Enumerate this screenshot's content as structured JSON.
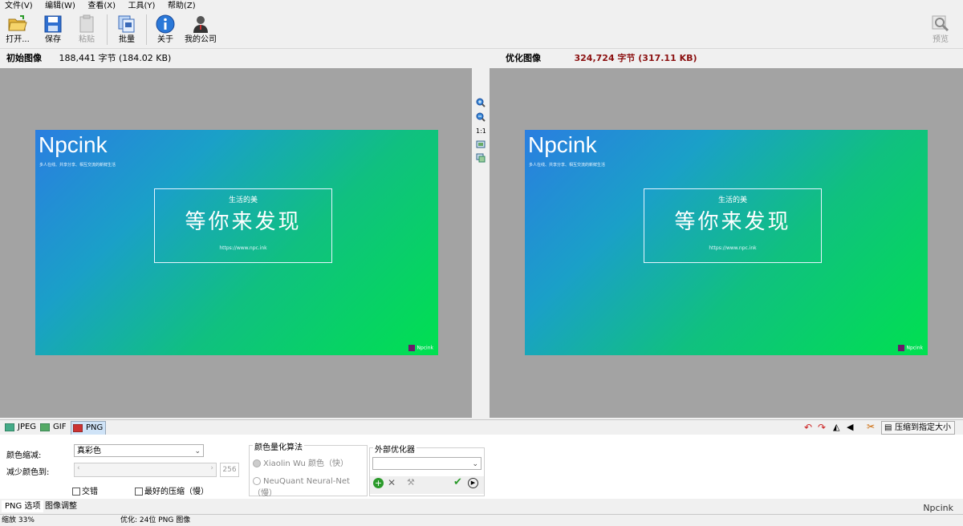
{
  "menu": [
    "文件(V)",
    "编辑(W)",
    "查看(X)",
    "工具(Y)",
    "帮助(Z)"
  ],
  "toolbar": {
    "open": "打开...",
    "save": "保存",
    "paste": "粘贴",
    "batch": "批量",
    "about": "关于",
    "company": "我的公司",
    "preview": "预览"
  },
  "original": {
    "title": "初始图像",
    "size": "188,441 字节 (184.02 KB)"
  },
  "optimized": {
    "title": "优化图像",
    "size": "324,724 字节 (317.11 KB)"
  },
  "image": {
    "brand": "Npcink",
    "tagline": "多人在线、共享分享、相互交流的新鲜生活",
    "subtitle": "生活的美",
    "headline": "等你来发现",
    "url": "https://www.npc.ink",
    "logo": "Npcink"
  },
  "zoom_ratio": "1:1",
  "format_tabs": [
    "JPEG",
    "GIF",
    "PNG"
  ],
  "compress_to_size": "压缩到指定大小",
  "png_options": {
    "color_reduction_label": "颜色缩减:",
    "color_reduction_value": "真彩色",
    "reduce_colors_label": "减少颜色到:",
    "reduce_colors_value": "256",
    "interlace": "交错",
    "best_compression": "最好的压缩（慢）",
    "quant_title": "颜色量化算法",
    "quant_options": [
      "Xiaolin Wu 颜色（快）",
      "NeuQuant Neural-Net（慢）"
    ],
    "external_title": "外部优化器"
  },
  "bottom_tabs": [
    "PNG 选项",
    "图像调整"
  ],
  "status": {
    "zoom": "缩放 33%",
    "info": "优化: 24位 PNG 图像"
  },
  "watermark": "Npcink"
}
